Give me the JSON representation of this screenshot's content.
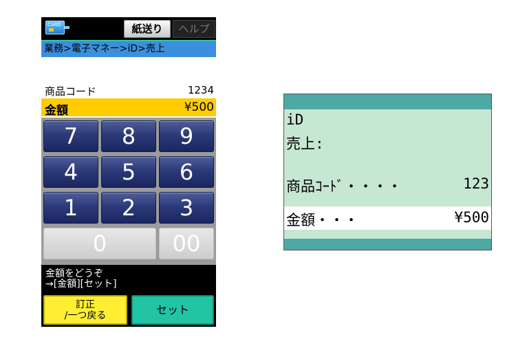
{
  "terminal": {
    "card_icon": {
      "name": "card-icon",
      "text": "CARD"
    },
    "top_bar": {
      "feed_label": "紙送り",
      "help_label": "ヘルプ"
    },
    "breadcrumb": "業務>電子マネー>iD>売上",
    "product_code": {
      "label": "商品コード",
      "value": "1234"
    },
    "amount": {
      "label": "金額",
      "value": "¥500"
    },
    "keypad": {
      "keys": [
        "7",
        "8",
        "9",
        "4",
        "5",
        "6",
        "1",
        "2",
        "3",
        "0",
        "00"
      ]
    },
    "message": {
      "line1": "金額をどうぞ",
      "line2": "→[金額][セット]"
    },
    "bottom_buttons": {
      "correct_line1": "訂正",
      "correct_line2": "/一つ戻る",
      "set_label": "セット"
    },
    "colors": {
      "amount_highlight": "#ffcc00",
      "key": "#2c3a7a",
      "correct_button": "#ffee33",
      "set_button": "#22c4a4"
    }
  },
  "lcd": {
    "line1": "iD",
    "line2": "売上:",
    "code_label": "商品ｺｰﾄﾞ・・・・",
    "code_value": "123",
    "amount_label": "金額・・・",
    "amount_value": "¥500",
    "colors": {
      "background": "#c6e7d2",
      "band": "#4ea8a4"
    }
  }
}
